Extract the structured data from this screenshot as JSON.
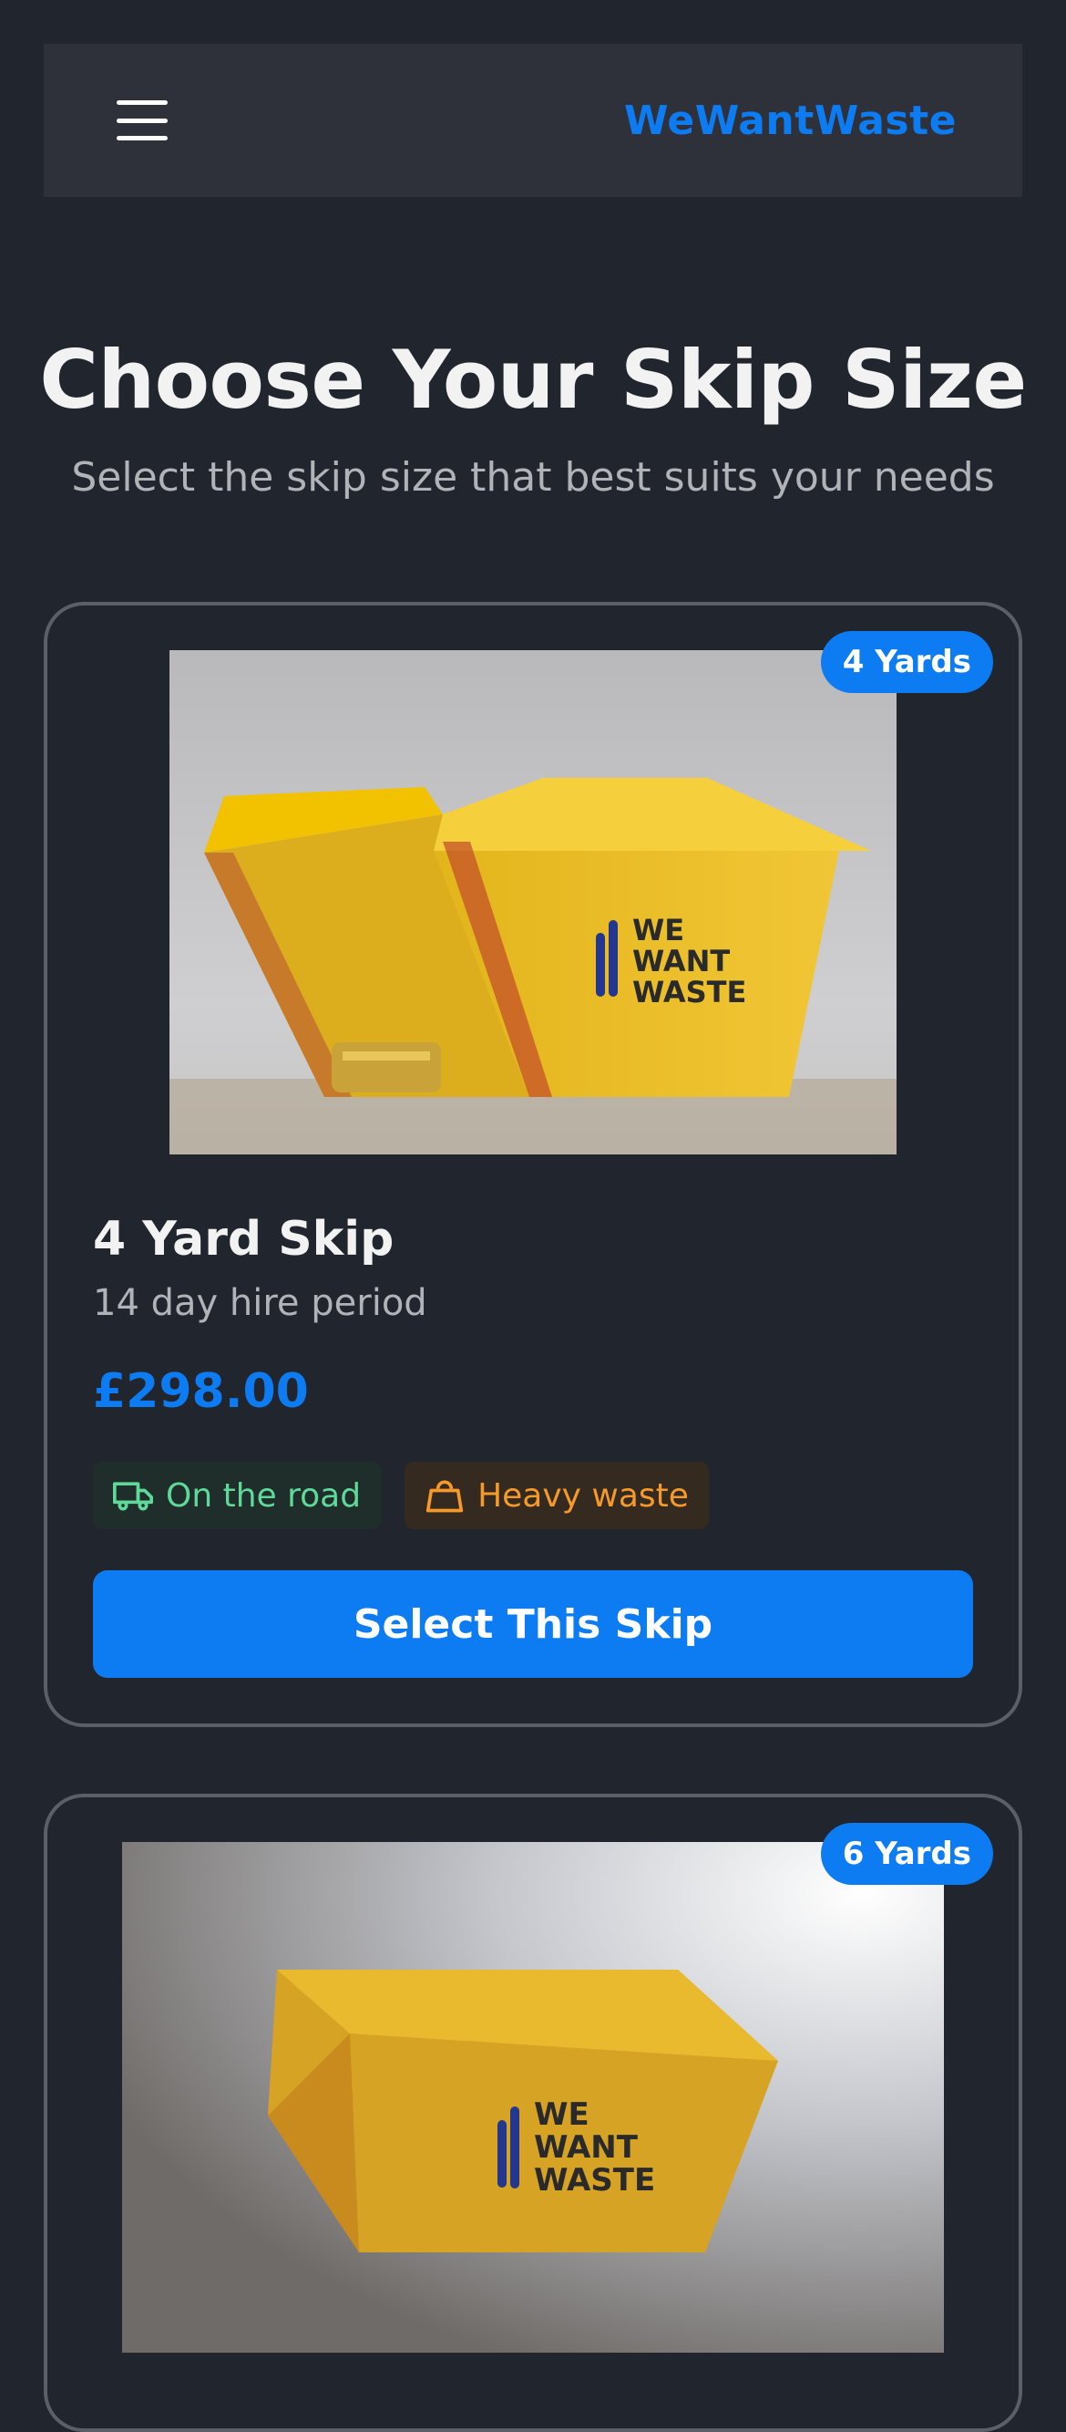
{
  "header": {
    "brand": "WeWantWaste",
    "menu_icon": "hamburger-menu-icon"
  },
  "page": {
    "title": "Choose Your Skip Size",
    "subtitle": "Select the skip size that best suits your needs"
  },
  "skips": [
    {
      "badge": "4 Yards",
      "name": "4 Yard Skip",
      "hire_period": "14 day hire period",
      "price": "£298.00",
      "tags": [
        {
          "label": "On the road",
          "icon": "truck-icon"
        },
        {
          "label": "Heavy waste",
          "icon": "weight-icon"
        }
      ],
      "button_label": "Select This Skip",
      "image_logo": [
        "WE",
        "WANT",
        "WASTE"
      ]
    },
    {
      "badge": "6 Yards",
      "image_logo": [
        "WE",
        "WANT",
        "WASTE"
      ]
    }
  ],
  "colors": {
    "accent": "#0d7cf2",
    "background": "#21252d",
    "road_tag": "#5fd99a",
    "heavy_tag": "#f59a2a"
  }
}
